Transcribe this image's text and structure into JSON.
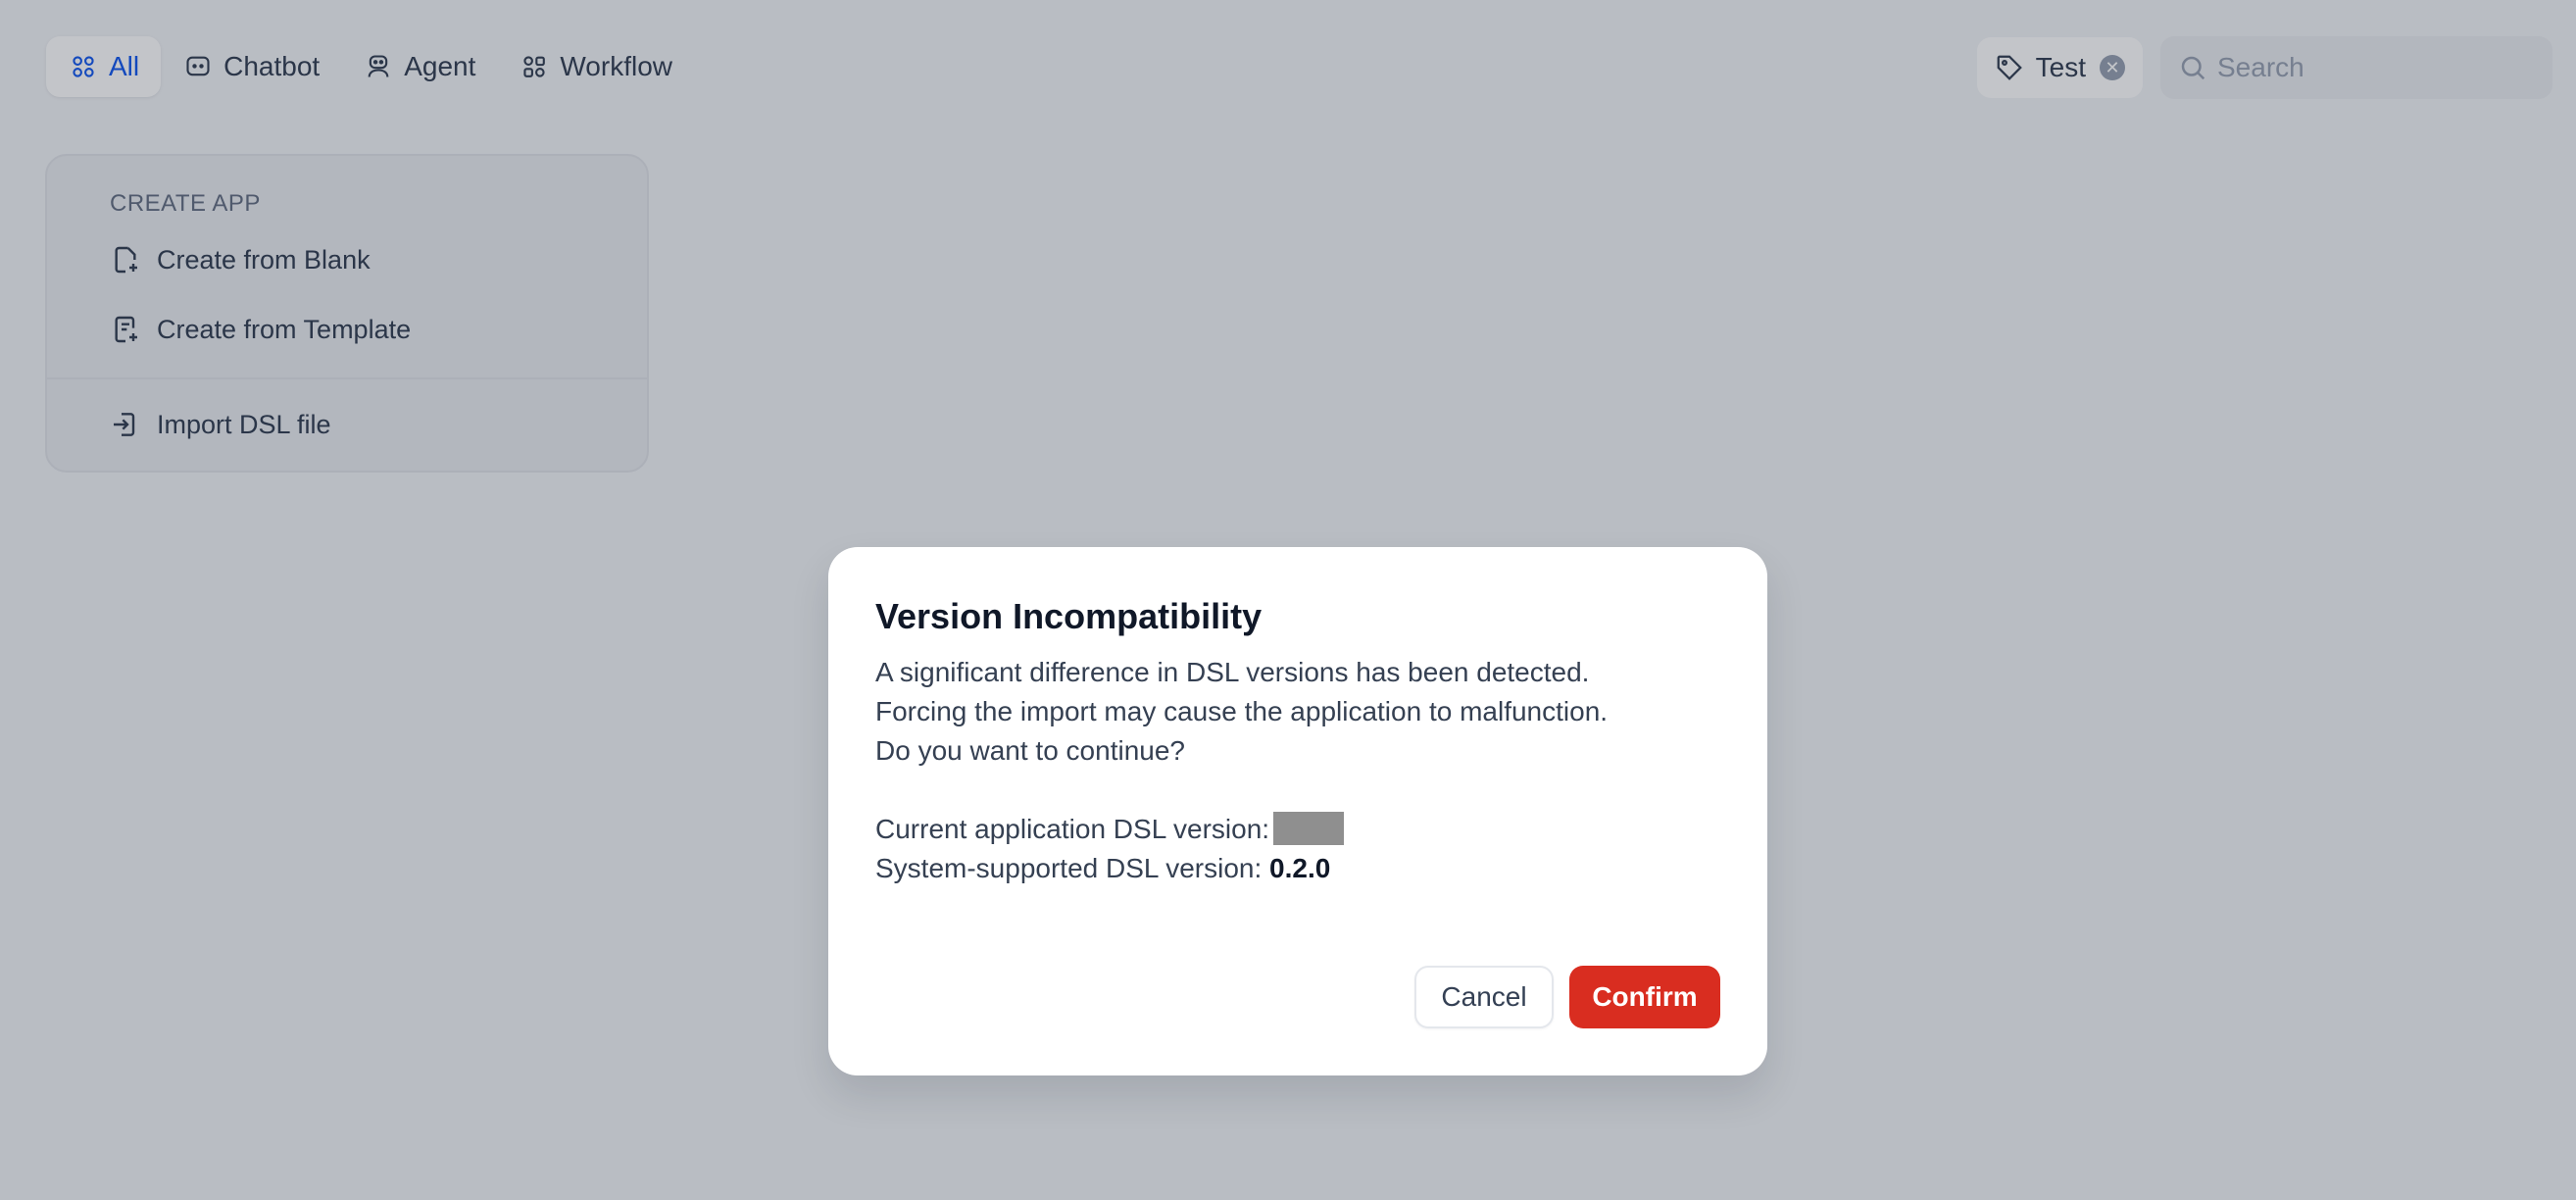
{
  "tabs": [
    {
      "label": "All",
      "icon": "grid-icon",
      "active": true
    },
    {
      "label": "Chatbot",
      "icon": "chat-bubble-icon",
      "active": false
    },
    {
      "label": "Agent",
      "icon": "robot-icon",
      "active": false
    },
    {
      "label": "Workflow",
      "icon": "workflow-icon",
      "active": false
    }
  ],
  "tag_filter": {
    "label": "Test",
    "icon": "tag-icon",
    "clear_icon": "clear-icon"
  },
  "search": {
    "placeholder": "Search",
    "value": ""
  },
  "create_app": {
    "title": "CREATE APP",
    "items": [
      {
        "label": "Create from Blank",
        "icon": "file-plus-icon"
      },
      {
        "label": "Create from Template",
        "icon": "template-icon"
      },
      {
        "label": "Import DSL file",
        "icon": "import-icon"
      }
    ]
  },
  "modal": {
    "title": "Version Incompatibility",
    "lines": [
      "A significant difference in DSL versions has been detected.",
      "Forcing the import may cause the application to malfunction.",
      "Do you want to continue?"
    ],
    "current_version_label": "Current application DSL version:",
    "supported_version_label": "System-supported DSL version:",
    "supported_version_value": "0.2.0",
    "cancel_label": "Cancel",
    "confirm_label": "Confirm"
  },
  "colors": {
    "accent": "#155aef",
    "danger": "#d92d20",
    "background": "#f2f4f7"
  }
}
